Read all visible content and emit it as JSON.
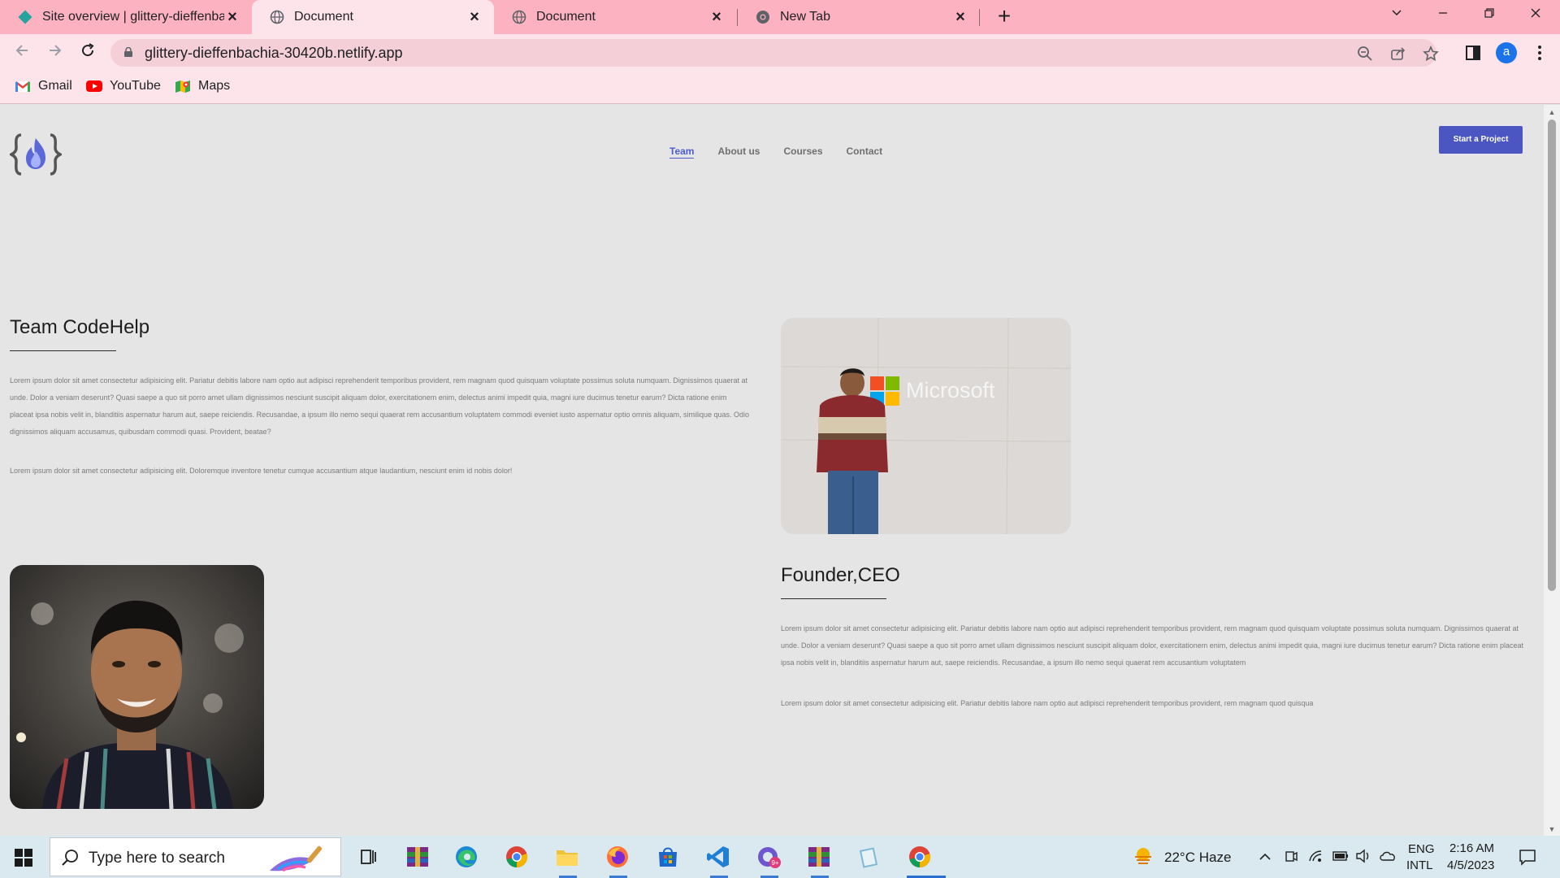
{
  "browser": {
    "tabs": [
      {
        "title": "Site overview | glittery-dieffenbachia-30420b",
        "icon": "netlify-icon",
        "active": false
      },
      {
        "title": "Document",
        "icon": "globe-icon",
        "active": true
      },
      {
        "title": "Document",
        "icon": "globe-icon",
        "active": false
      },
      {
        "title": "New Tab",
        "icon": "chrome-icon",
        "active": false
      }
    ],
    "url": "glittery-dieffenbachia-30420b.netlify.app",
    "profile_initial": "a",
    "bookmarks": [
      {
        "label": "Gmail",
        "icon": "gmail-icon"
      },
      {
        "label": "YouTube",
        "icon": "youtube-icon"
      },
      {
        "label": "Maps",
        "icon": "maps-icon"
      }
    ]
  },
  "site": {
    "nav": [
      {
        "label": "Team",
        "current": true
      },
      {
        "label": "About us",
        "current": false
      },
      {
        "label": "Courses",
        "current": false
      },
      {
        "label": "Contact",
        "current": false
      }
    ],
    "cta_label": "Start a Project",
    "team_section": {
      "title": "Team CodeHelp",
      "paragraph_1": "Lorem ipsum dolor sit amet consectetur adipisicing elit. Pariatur debitis labore nam optio aut adipisci reprehenderit temporibus provident, rem magnam quod quisquam voluptate possimus soluta numquam. Dignissimos quaerat at unde. Dolor a veniam deserunt? Quasi saepe a quo sit porro amet ullam dignissimos nesciunt suscipit aliquam dolor, exercitationem enim, delectus animi impedit quia, magni iure ducimus tenetur earum? Dicta ratione enim placeat ipsa nobis velit in, blanditiis aspernatur harum aut, saepe reiciendis. Recusandae, a ipsum illo nemo sequi quaerat rem accusantium voluptatem commodi eveniet iusto aspernatur optio omnis aliquam, similique quas. Odio dignissimos aliquam accusamus, quibusdam commodi quasi. Provident, beatae?",
      "paragraph_2": "Lorem ipsum dolor sit amet consectetur adipisicing elit. Doloremque inventore tenetur cumque accusantium atque laudantium, nesciunt enim id nobis dolor!"
    },
    "founder_section": {
      "title": "Founder,CEO",
      "paragraph_1": "Lorem ipsum dolor sit amet consectetur adipisicing elit. Pariatur debitis labore nam optio aut adipisci reprehenderit temporibus provident, rem magnam quod quisquam voluptate possimus soluta numquam. Dignissimos quaerat at unde. Dolor a veniam deserunt? Quasi saepe a quo sit porro amet ullam dignissimos nesciunt suscipit aliquam dolor, exercitationem enim, delectus animi impedit quia, magni iure ducimus tenetur earum? Dicta ratione enim placeat ipsa nobis velit in, blanditiis aspernatur harum aut, saepe reiciendis. Recusandae, a ipsum illo nemo sequi quaerat rem accusantium voluptatem",
      "paragraph_2": "Lorem ipsum dolor sit amet consectetur adipisicing elit. Pariatur debitis labore nam optio aut adipisci reprehenderit temporibus provident, rem magnam quod quisqua"
    },
    "photo_1_sign_text": "Microsoft"
  },
  "taskbar": {
    "search_placeholder": "Type here to search",
    "weather": "22°C  Haze",
    "language_line1": "ENG",
    "language_line2": "INTL",
    "time": "2:16 AM",
    "date": "4/5/2023"
  },
  "colors": {
    "tabbar": "#fcb2c0",
    "toolbar": "#fde4ea",
    "page_bg": "#e5e5e5",
    "accent": "#4c56c2"
  }
}
